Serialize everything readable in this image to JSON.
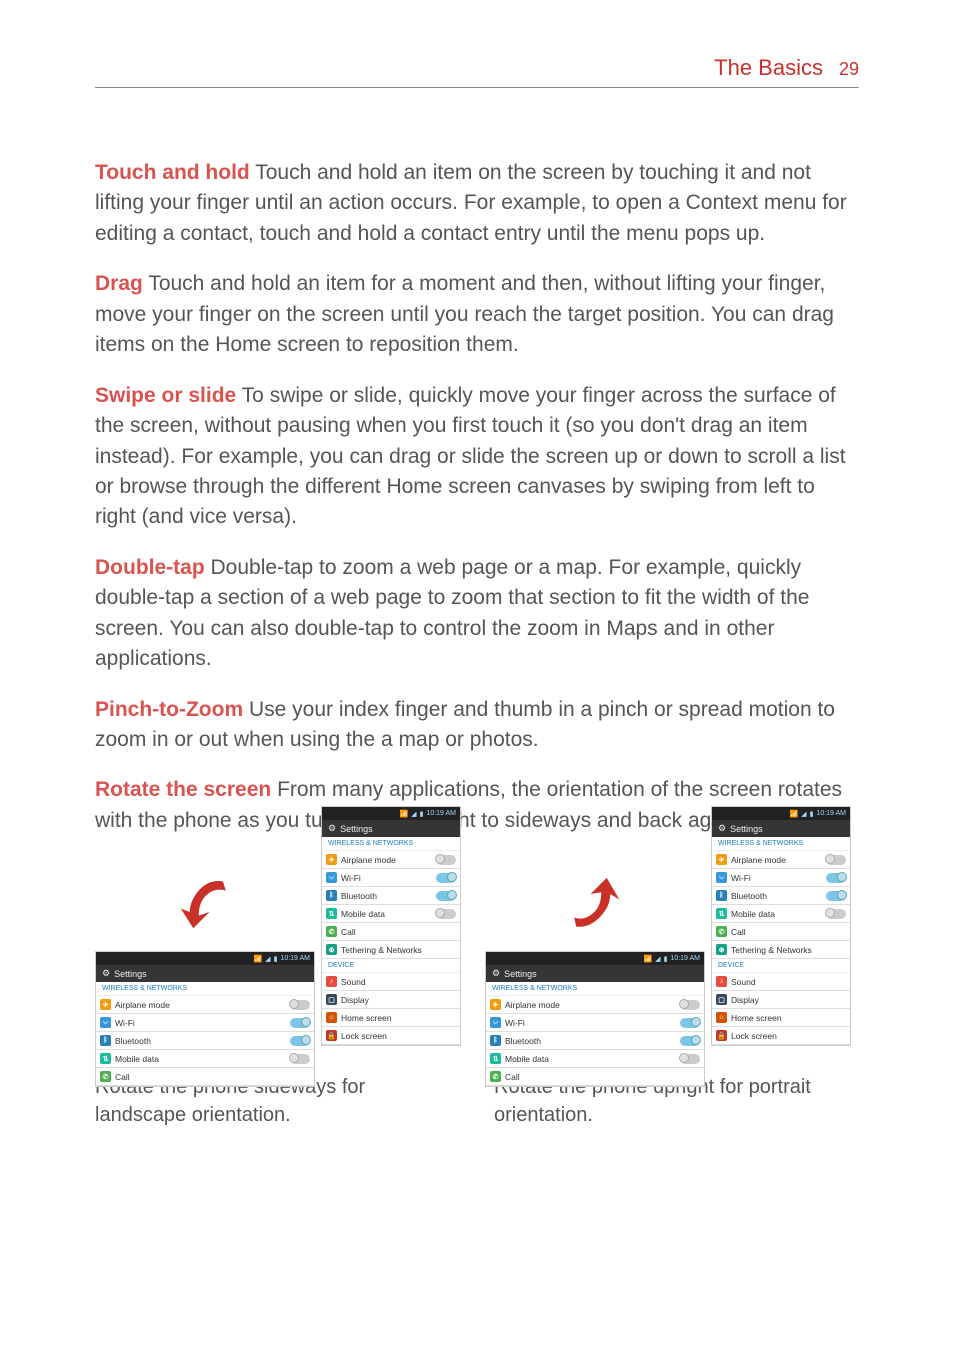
{
  "header": {
    "section": "The Basics",
    "page": "29"
  },
  "paragraphs": {
    "touchhold": {
      "term": "Touch and hold",
      "body": "  Touch and hold an item on the screen by touching it and not lifting your finger until an action occurs. For example, to open a Context menu for editing a contact, touch and hold a contact entry until the menu pops up."
    },
    "drag": {
      "term": "Drag",
      "body": "  Touch and hold an item for a moment and then, without lifting your finger, move your finger on the screen until you reach the target position. You can drag items on the Home screen to reposition them."
    },
    "swipe": {
      "term": "Swipe or slide",
      "body": "  To swipe or slide, quickly move your finger across the surface of the screen, without pausing when you first touch it (so you don't drag an item instead). For example, you can drag or slide the screen up or down to scroll a list or browse through the different Home screen canvases by swiping from left to right (and vice versa)."
    },
    "doubletap": {
      "term": "Double-tap",
      "body": "  Double-tap to zoom a web page or a map. For example, quickly double-tap a section of a web page to zoom that section to fit the width of the screen. You can also double-tap to control the zoom in Maps and in other applications."
    },
    "pinch": {
      "term": "Pinch-to-Zoom",
      "body": "  Use your index finger and thumb in a pinch or spread motion to zoom in or out when using the a map or photos."
    },
    "rotate": {
      "term": "Rotate the screen",
      "body": "  From many applications, the orientation of the screen rotates with the phone as you turn it from upright to sideways and back again."
    }
  },
  "status": {
    "time": "10:19 AM"
  },
  "settings": {
    "title": "Settings",
    "cat_wireless": "WIRELESS & NETWORKS",
    "cat_device": "DEVICE",
    "items": {
      "airplane": "Airplane mode",
      "wifi": "Wi-Fi",
      "bluetooth": "Bluetooth",
      "mobiledata": "Mobile data",
      "call": "Call",
      "tethering": "Tethering & Networks",
      "sound": "Sound",
      "display": "Display",
      "homescreen": "Home screen",
      "lockscreen": "Lock screen"
    }
  },
  "captions": {
    "left": "Rotate the phone sideways for landscape orientation.",
    "right": "Rotate the phone upright for portrait orientation."
  }
}
